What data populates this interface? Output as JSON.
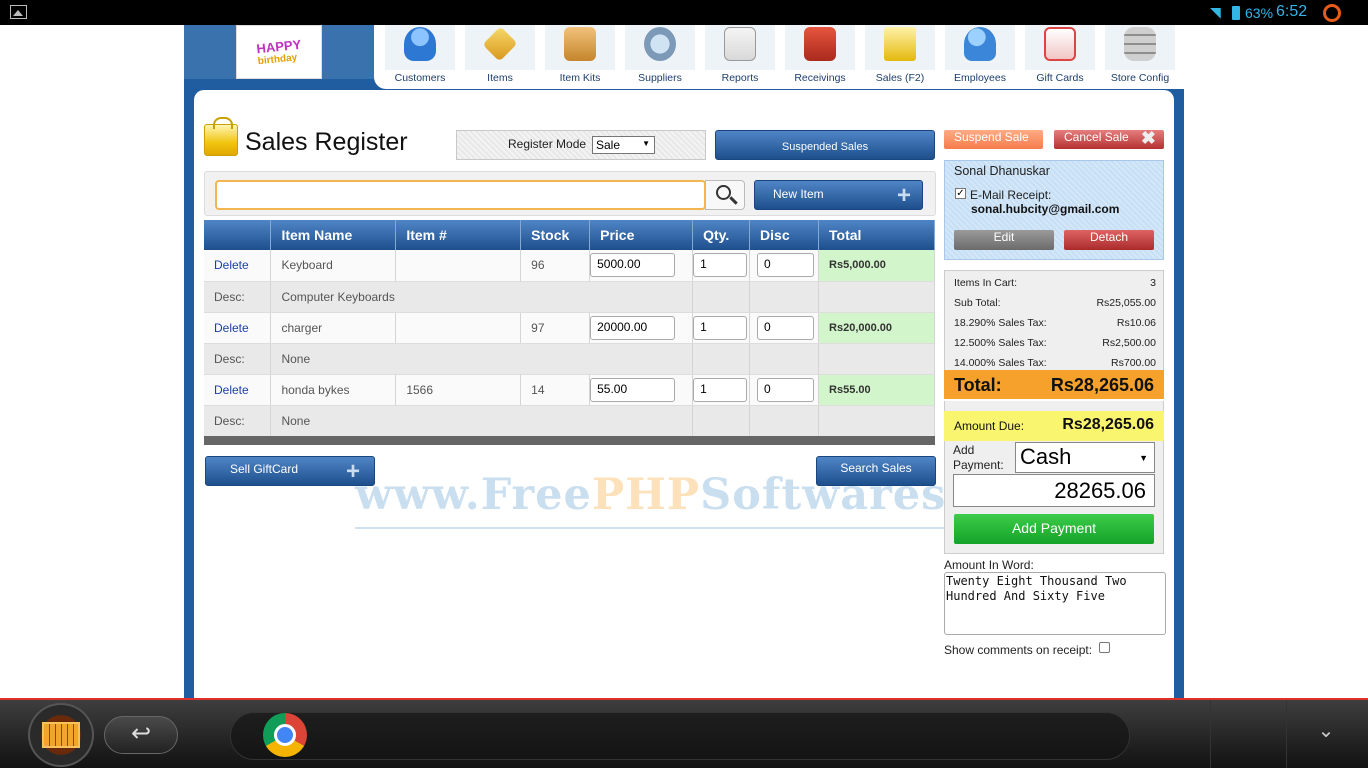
{
  "statusbar": {
    "battery": "63%",
    "time": "6:52"
  },
  "logo": {
    "line1": "HAPPY",
    "line2": "birthday"
  },
  "nav": [
    {
      "label": "Customers",
      "icon": "customers-icon"
    },
    {
      "label": "Items",
      "icon": "items-icon"
    },
    {
      "label": "Item Kits",
      "icon": "item-kits-icon"
    },
    {
      "label": "Suppliers",
      "icon": "suppliers-icon"
    },
    {
      "label": "Reports",
      "icon": "reports-icon"
    },
    {
      "label": "Receivings",
      "icon": "receivings-icon"
    },
    {
      "label": "Sales (F2)",
      "icon": "sales-icon"
    },
    {
      "label": "Employees",
      "icon": "employees-icon"
    },
    {
      "label": "Gift Cards",
      "icon": "gift-cards-icon"
    },
    {
      "label": "Store Config",
      "icon": "store-config-icon"
    }
  ],
  "page": {
    "title": "Sales Register"
  },
  "register": {
    "mode_label": "Register Mode",
    "mode_value": "Sale"
  },
  "buttons": {
    "suspended_sales": "Suspended Sales",
    "new_item": "New Item",
    "sell_giftcard": "Sell GiftCard",
    "search_sales": "Search Sales",
    "suspend_sale": "Suspend Sale",
    "cancel_sale": "Cancel Sale",
    "edit": "Edit",
    "detach": "Detach",
    "add_payment": "Add Payment"
  },
  "search": {
    "value": ""
  },
  "table": {
    "headers": [
      "",
      "Item Name",
      "Item #",
      "Stock",
      "Price",
      "Qty.",
      "Disc",
      "Total"
    ],
    "delete_label": "Delete",
    "desc_label": "Desc:",
    "rows": [
      {
        "name": "Keyboard",
        "item_no": "",
        "stock": "96",
        "price": "5000.00",
        "qty": "1",
        "disc": "0",
        "total": "Rs5,000.00",
        "desc": "Computer Keyboards"
      },
      {
        "name": "charger",
        "item_no": "",
        "stock": "97",
        "price": "20000.00",
        "qty": "1",
        "disc": "0",
        "total": "Rs20,000.00",
        "desc": "None"
      },
      {
        "name": "honda bykes",
        "item_no": "1566",
        "stock": "14",
        "price": "55.00",
        "qty": "1",
        "disc": "0",
        "total": "Rs55.00",
        "desc": "None"
      }
    ]
  },
  "customer": {
    "name": "Sonal Dhanuskar",
    "email_receipt_label": "E-Mail Receipt:",
    "email": "sonal.hubcity@gmail.com",
    "email_receipt_checked": true
  },
  "summary": {
    "rows": [
      {
        "label": "Items In Cart:",
        "value": "3"
      },
      {
        "label": "Sub Total:",
        "value": "Rs25,055.00"
      },
      {
        "label": "18.290% Sales Tax:",
        "value": "Rs10.06"
      },
      {
        "label": "12.500% Sales Tax:",
        "value": "Rs2,500.00"
      },
      {
        "label": "14.000% Sales Tax:",
        "value": "Rs700.00"
      }
    ],
    "total_label": "Total:",
    "total_value": "Rs28,265.06",
    "amount_due_label": "Amount Due:",
    "amount_due_value": "Rs28,265.06"
  },
  "payment": {
    "add_payment_label_1": "Add",
    "add_payment_label_2": "Payment:",
    "type": "Cash",
    "amount": "28265.06"
  },
  "amount_in_word": {
    "label": "Amount In Word:",
    "value": "Twenty Eight Thousand Two Hundred And Sixty Five"
  },
  "comments": {
    "label": "Show comments on receipt:"
  },
  "watermark": {
    "text_a": "www.Free",
    "text_b": "PHP",
    "text_c": "Softwares.com"
  },
  "colors": {
    "primary_blue": "#1f5da0",
    "total_orange": "#f5a12c",
    "due_yellow": "#f9f56e",
    "add_payment_green": "#14a328",
    "total_cell_green": "#d3f5cc"
  }
}
